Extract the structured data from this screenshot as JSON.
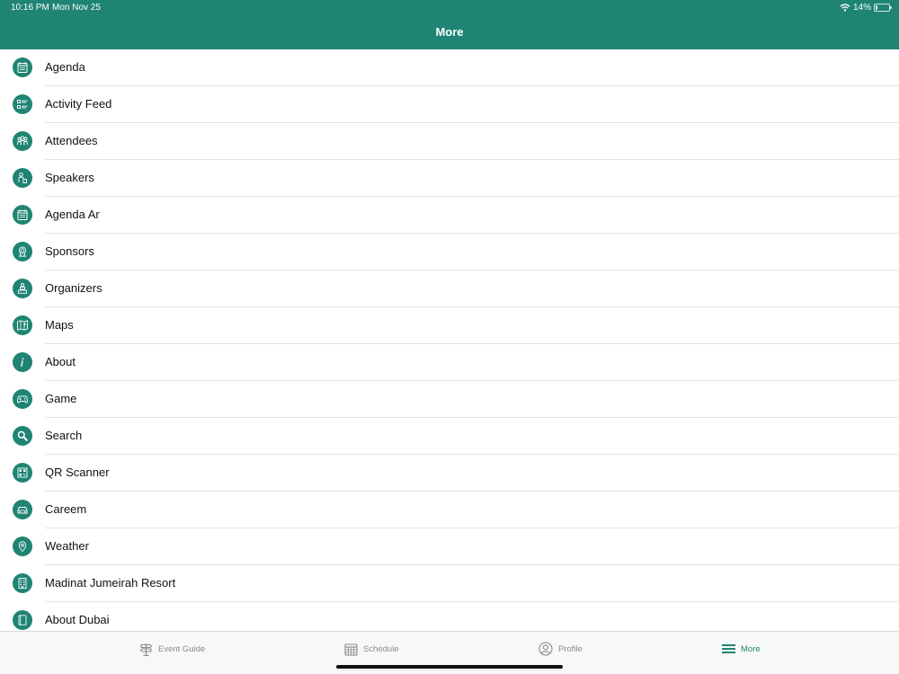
{
  "status": {
    "time": "10:16 PM",
    "date": "Mon Nov 25",
    "battery": "14%",
    "battery_level": 0.14
  },
  "header": {
    "title": "More"
  },
  "menu": [
    {
      "label": "Agenda",
      "icon": "calendar-icon"
    },
    {
      "label": "Activity Feed",
      "icon": "feed-list-icon"
    },
    {
      "label": "Attendees",
      "icon": "people-icon"
    },
    {
      "label": "Speakers",
      "icon": "speaker-icon"
    },
    {
      "label": "Agenda Ar",
      "icon": "calendar-icon"
    },
    {
      "label": "Sponsors",
      "icon": "ribbon-icon"
    },
    {
      "label": "Organizers",
      "icon": "organizer-icon"
    },
    {
      "label": "Maps",
      "icon": "map-icon"
    },
    {
      "label": "About",
      "icon": "info-icon"
    },
    {
      "label": "Game",
      "icon": "game-icon"
    },
    {
      "label": "Search",
      "icon": "search-icon"
    },
    {
      "label": "QR Scanner",
      "icon": "qr-icon"
    },
    {
      "label": "Careem",
      "icon": "car-icon"
    },
    {
      "label": "Weather",
      "icon": "location-icon"
    },
    {
      "label": "Madinat Jumeirah Resort",
      "icon": "building-icon"
    },
    {
      "label": "About Dubai",
      "icon": "book-icon"
    }
  ],
  "tabs": [
    {
      "label": "Event Guide",
      "icon": "signpost-icon",
      "active": false
    },
    {
      "label": "Schedule",
      "icon": "calendar-icon",
      "active": false
    },
    {
      "label": "Profile",
      "icon": "profile-icon",
      "active": false
    },
    {
      "label": "More",
      "icon": "hamburger-icon",
      "active": true
    }
  ],
  "colors": {
    "accent": "#1f8473",
    "inactive": "#8a8a8a"
  }
}
